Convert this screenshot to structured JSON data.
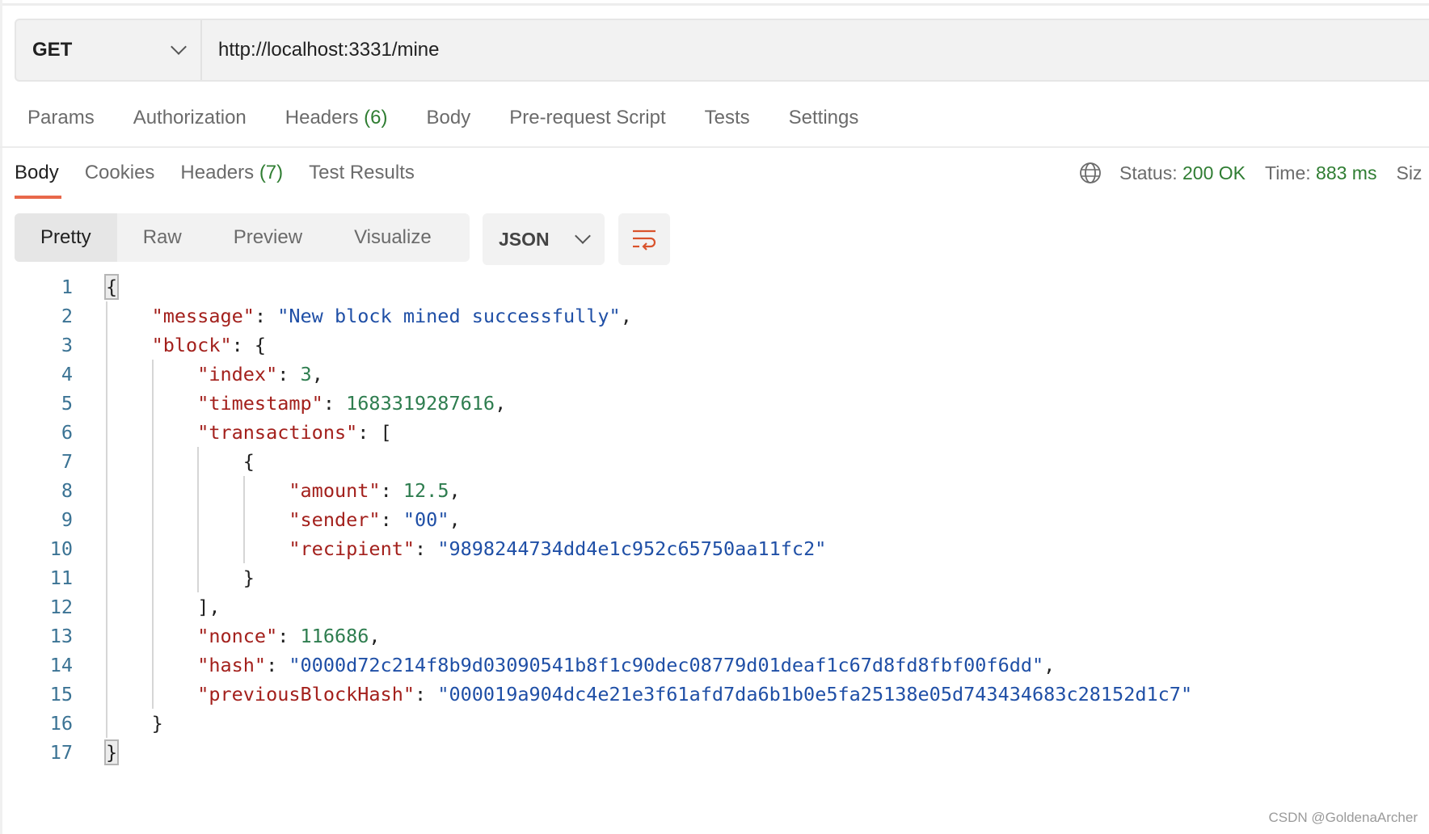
{
  "request": {
    "method": "GET",
    "url": "http://localhost:3331/mine",
    "tabs": [
      {
        "label": "Params",
        "count": ""
      },
      {
        "label": "Authorization",
        "count": ""
      },
      {
        "label": "Headers",
        "count": "(6)"
      },
      {
        "label": "Body",
        "count": ""
      },
      {
        "label": "Pre-request Script",
        "count": ""
      },
      {
        "label": "Tests",
        "count": ""
      },
      {
        "label": "Settings",
        "count": ""
      }
    ]
  },
  "response": {
    "tabs": [
      {
        "label": "Body",
        "count": "",
        "active": true
      },
      {
        "label": "Cookies",
        "count": ""
      },
      {
        "label": "Headers",
        "count": "(7)"
      },
      {
        "label": "Test Results",
        "count": ""
      }
    ],
    "status_label": "Status:",
    "status_value": "200 OK",
    "time_label": "Time:",
    "time_value": "883 ms",
    "size_label": "Siz",
    "globe_icon": "globe-icon",
    "view_modes": [
      "Pretty",
      "Raw",
      "Preview",
      "Visualize"
    ],
    "active_view": "Pretty",
    "format": "JSON",
    "wrap_icon": "wrap-lines-icon"
  },
  "colors": {
    "accent": "#e8684a",
    "status_green": "#2f7d32",
    "key": "#a3201c",
    "string": "#1f4fa6",
    "number": "#2e7d4f"
  },
  "code_lines": [
    {
      "indent": 0,
      "tokens": [
        {
          "t": "bm",
          "v": "{"
        }
      ]
    },
    {
      "indent": 1,
      "tokens": [
        {
          "t": "k",
          "v": "\"message\""
        },
        {
          "t": "p",
          "v": ": "
        },
        {
          "t": "s",
          "v": "\"New block mined successfully\""
        },
        {
          "t": "p",
          "v": ","
        }
      ]
    },
    {
      "indent": 1,
      "tokens": [
        {
          "t": "k",
          "v": "\"block\""
        },
        {
          "t": "p",
          "v": ": {"
        }
      ]
    },
    {
      "indent": 2,
      "tokens": [
        {
          "t": "k",
          "v": "\"index\""
        },
        {
          "t": "p",
          "v": ": "
        },
        {
          "t": "n",
          "v": "3"
        },
        {
          "t": "p",
          "v": ","
        }
      ]
    },
    {
      "indent": 2,
      "tokens": [
        {
          "t": "k",
          "v": "\"timestamp\""
        },
        {
          "t": "p",
          "v": ": "
        },
        {
          "t": "n",
          "v": "1683319287616"
        },
        {
          "t": "p",
          "v": ","
        }
      ]
    },
    {
      "indent": 2,
      "tokens": [
        {
          "t": "k",
          "v": "\"transactions\""
        },
        {
          "t": "p",
          "v": ": ["
        }
      ]
    },
    {
      "indent": 3,
      "tokens": [
        {
          "t": "p",
          "v": "{"
        }
      ]
    },
    {
      "indent": 4,
      "tokens": [
        {
          "t": "k",
          "v": "\"amount\""
        },
        {
          "t": "p",
          "v": ": "
        },
        {
          "t": "n",
          "v": "12.5"
        },
        {
          "t": "p",
          "v": ","
        }
      ]
    },
    {
      "indent": 4,
      "tokens": [
        {
          "t": "k",
          "v": "\"sender\""
        },
        {
          "t": "p",
          "v": ": "
        },
        {
          "t": "s",
          "v": "\"00\""
        },
        {
          "t": "p",
          "v": ","
        }
      ]
    },
    {
      "indent": 4,
      "tokens": [
        {
          "t": "k",
          "v": "\"recipient\""
        },
        {
          "t": "p",
          "v": ": "
        },
        {
          "t": "s",
          "v": "\"9898244734dd4e1c952c65750aa11fc2\""
        }
      ]
    },
    {
      "indent": 3,
      "tokens": [
        {
          "t": "p",
          "v": "}"
        }
      ]
    },
    {
      "indent": 2,
      "tokens": [
        {
          "t": "p",
          "v": "],"
        }
      ]
    },
    {
      "indent": 2,
      "tokens": [
        {
          "t": "k",
          "v": "\"nonce\""
        },
        {
          "t": "p",
          "v": ": "
        },
        {
          "t": "n",
          "v": "116686"
        },
        {
          "t": "p",
          "v": ","
        }
      ]
    },
    {
      "indent": 2,
      "tokens": [
        {
          "t": "k",
          "v": "\"hash\""
        },
        {
          "t": "p",
          "v": ": "
        },
        {
          "t": "s",
          "v": "\"0000d72c214f8b9d03090541b8f1c90dec08779d01deaf1c67d8fd8fbf00f6dd\""
        },
        {
          "t": "p",
          "v": ","
        }
      ]
    },
    {
      "indent": 2,
      "tokens": [
        {
          "t": "k",
          "v": "\"previousBlockHash\""
        },
        {
          "t": "p",
          "v": ": "
        },
        {
          "t": "s",
          "v": "\"000019a904dc4e21e3f61afd7da6b1b0e5fa25138e05d743434683c28152d1c7\""
        }
      ]
    },
    {
      "indent": 1,
      "tokens": [
        {
          "t": "p",
          "v": "}"
        }
      ]
    },
    {
      "indent": 0,
      "tokens": [
        {
          "t": "bm",
          "v": "}"
        }
      ]
    }
  ],
  "watermark": "CSDN @GoldenaArcher"
}
